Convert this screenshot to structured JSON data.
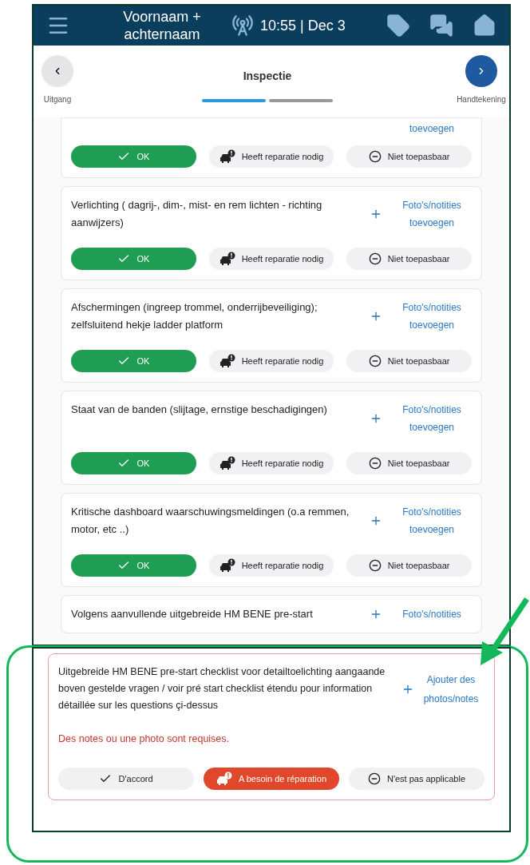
{
  "header": {
    "user_name": "Voornaam + achternaam",
    "time": "10:55 | Dec 3"
  },
  "stepper": {
    "back_label": "Uitgang",
    "title": "Inspectie",
    "next_label": "Handtekening",
    "steps": [
      {
        "selected": true
      },
      {
        "selected": false
      }
    ]
  },
  "items": [
    {
      "link_lines": [
        "toevoegen"
      ],
      "answers": [
        {
          "kind": "ok",
          "label": "OK",
          "selected": true
        },
        {
          "kind": "repair",
          "label": "Heeft reparatie nodig",
          "selected": false
        },
        {
          "kind": "na",
          "label": "Niet toepasbaar",
          "selected": false
        }
      ]
    },
    {
      "question": "Verlichting ( dagrij-, dim-, mist- en rem lichten - richting aanwijzers)",
      "link_lines": [
        "Foto's/notities",
        "toevoegen"
      ],
      "answers": [
        {
          "kind": "ok",
          "label": "OK",
          "selected": true
        },
        {
          "kind": "repair",
          "label": "Heeft reparatie nodig",
          "selected": false
        },
        {
          "kind": "na",
          "label": "Niet toepasbaar",
          "selected": false
        }
      ]
    },
    {
      "question": "Afschermingen (ingreep trommel, onderrijbeveiliging); zelfsluitend hekje ladder platform",
      "link_lines": [
        "Foto's/notities",
        "toevoegen"
      ],
      "answers": [
        {
          "kind": "ok",
          "label": "OK",
          "selected": true
        },
        {
          "kind": "repair",
          "label": "Heeft reparatie nodig",
          "selected": false
        },
        {
          "kind": "na",
          "label": "Niet toepasbaar",
          "selected": false
        }
      ]
    },
    {
      "question": "Staat van de banden (slijtage, ernstige beschadigingen)",
      "link_lines": [
        "Foto's/notities",
        "toevoegen"
      ],
      "answers": [
        {
          "kind": "ok",
          "label": "OK",
          "selected": true
        },
        {
          "kind": "repair",
          "label": "Heeft reparatie nodig",
          "selected": false
        },
        {
          "kind": "na",
          "label": "Niet toepasbaar",
          "selected": false
        }
      ]
    },
    {
      "question": "Kritische dashboard waarschuwingsmeldingen (o.a remmen, motor, etc ..)",
      "link_lines": [
        "Foto's/notities",
        "toevoegen"
      ],
      "answers": [
        {
          "kind": "ok",
          "label": "OK",
          "selected": true
        },
        {
          "kind": "repair",
          "label": "Heeft reparatie nodig",
          "selected": false
        },
        {
          "kind": "na",
          "label": "Niet toepasbaar",
          "selected": false
        }
      ]
    },
    {
      "question": "Volgens aanvullende uitgebreide HM BENE pre-start",
      "link_lines": [
        "Foto's/notities"
      ]
    }
  ],
  "overlay": {
    "question": "Uitgebreide HM BENE pre-start checklist voor detailtoelichting aangaande boven gestelde vragen / voir pré start checklist étendu pour information détaillée sur les questions çi-dessus",
    "link_lines": [
      "Ajouter des",
      "photos/notes"
    ],
    "error": "Des notes ou une photo sont requises.",
    "answers": [
      {
        "kind": "ok",
        "label": "D'accord",
        "selected": false
      },
      {
        "kind": "repair",
        "label": "A besoin de réparation",
        "selected": true
      },
      {
        "kind": "na",
        "label": "N'est pas applicable",
        "selected": false
      }
    ]
  }
}
